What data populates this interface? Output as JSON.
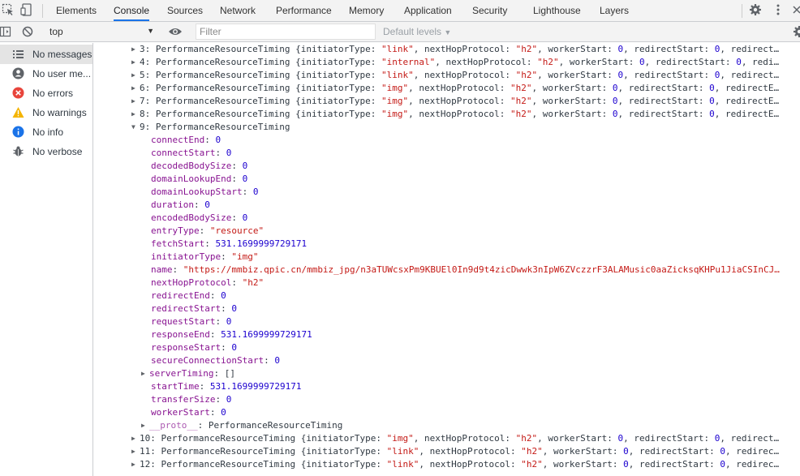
{
  "tabs": [
    "Elements",
    "Console",
    "Sources",
    "Network",
    "Performance",
    "Memory",
    "Application",
    "Security",
    "Lighthouse",
    "Layers"
  ],
  "toolbar": {
    "context": "top",
    "filter_placeholder": "Filter",
    "levels": "Default levels"
  },
  "sidebar": {
    "items": [
      {
        "label": "No messages",
        "icon": "list-icon"
      },
      {
        "label": "No user me...",
        "icon": "user-icon"
      },
      {
        "label": "No errors",
        "icon": "error-icon"
      },
      {
        "label": "No warnings",
        "icon": "warning-icon"
      },
      {
        "label": "No info",
        "icon": "info-icon"
      },
      {
        "label": "No verbose",
        "icon": "bug-icon"
      }
    ]
  },
  "colors": {
    "property": "#881391",
    "string": "#c41a16",
    "number": "#1c00cf",
    "accent": "#1a73e8"
  },
  "console": {
    "summary_rows": [
      {
        "index": "3:",
        "type": "PerformanceResourceTiming",
        "preview": " {initiatorType: ",
        "initiator": "\"link\"",
        "rest": ", nextHopProtocol: \"h2\", workerStart: 0, redirectStart: 0, redirect…"
      },
      {
        "index": "4:",
        "type": "PerformanceResourceTiming",
        "preview": " {initiatorType: ",
        "initiator": "\"internal\"",
        "rest": ", nextHopProtocol: \"h2\", workerStart: 0, redirectStart: 0, redi…"
      },
      {
        "index": "5:",
        "type": "PerformanceResourceTiming",
        "preview": " {initiatorType: ",
        "initiator": "\"link\"",
        "rest": ", nextHopProtocol: \"h2\", workerStart: 0, redirectStart: 0, redirect…"
      },
      {
        "index": "6:",
        "type": "PerformanceResourceTiming",
        "preview": " {initiatorType: ",
        "initiator": "\"img\"",
        "rest": ", nextHopProtocol: \"h2\", workerStart: 0, redirectStart: 0, redirectE…"
      },
      {
        "index": "7:",
        "type": "PerformanceResourceTiming",
        "preview": " {initiatorType: ",
        "initiator": "\"img\"",
        "rest": ", nextHopProtocol: \"h2\", workerStart: 0, redirectStart: 0, redirectE…"
      },
      {
        "index": "8:",
        "type": "PerformanceResourceTiming",
        "preview": " {initiatorType: ",
        "initiator": "\"img\"",
        "rest": ", nextHopProtocol: \"h2\", workerStart: 0, redirectStart: 0, redirectE…"
      }
    ],
    "expanded": {
      "index": "9:",
      "type": "PerformanceResourceTiming",
      "props": [
        {
          "key": "connectEnd",
          "value": "0",
          "kind": "num"
        },
        {
          "key": "connectStart",
          "value": "0",
          "kind": "num"
        },
        {
          "key": "decodedBodySize",
          "value": "0",
          "kind": "num"
        },
        {
          "key": "domainLookupEnd",
          "value": "0",
          "kind": "num"
        },
        {
          "key": "domainLookupStart",
          "value": "0",
          "kind": "num"
        },
        {
          "key": "duration",
          "value": "0",
          "kind": "num"
        },
        {
          "key": "encodedBodySize",
          "value": "0",
          "kind": "num"
        },
        {
          "key": "entryType",
          "value": "\"resource\"",
          "kind": "str"
        },
        {
          "key": "fetchStart",
          "value": "531.1699999729171",
          "kind": "num"
        },
        {
          "key": "initiatorType",
          "value": "\"img\"",
          "kind": "str"
        },
        {
          "key": "name",
          "value": "\"https://mmbiz.qpic.cn/mmbiz_jpg/n3aTUWcsxPm9KBUEl0In9d9t4zicDwwk3nIpW6ZVczzrF3ALAMusic0aaZicksqKHPu1JiaCSInCJ…",
          "kind": "str"
        },
        {
          "key": "nextHopProtocol",
          "value": "\"h2\"",
          "kind": "str"
        },
        {
          "key": "redirectEnd",
          "value": "0",
          "kind": "num"
        },
        {
          "key": "redirectStart",
          "value": "0",
          "kind": "num"
        },
        {
          "key": "requestStart",
          "value": "0",
          "kind": "num"
        },
        {
          "key": "responseEnd",
          "value": "531.1699999729171",
          "kind": "num"
        },
        {
          "key": "responseStart",
          "value": "0",
          "kind": "num"
        },
        {
          "key": "secureConnectionStart",
          "value": "0",
          "kind": "num"
        },
        {
          "key": "serverTiming",
          "value": "[]",
          "kind": "obj",
          "expandable": true
        },
        {
          "key": "startTime",
          "value": "531.1699999729171",
          "kind": "num"
        },
        {
          "key": "transferSize",
          "value": "0",
          "kind": "num"
        },
        {
          "key": "workerStart",
          "value": "0",
          "kind": "num"
        },
        {
          "key": "__proto__",
          "value": "PerformanceResourceTiming",
          "kind": "obj",
          "expandable": true,
          "dim": true
        }
      ]
    },
    "tail_rows": [
      {
        "index": "10:",
        "type": "PerformanceResourceTiming",
        "preview": " {initiatorType: ",
        "initiator": "\"img\"",
        "rest": ", nextHopProtocol: \"h2\", workerStart: 0, redirectStart: 0, redirect…"
      },
      {
        "index": "11:",
        "type": "PerformanceResourceTiming",
        "preview": " {initiatorType: ",
        "initiator": "\"link\"",
        "rest": ", nextHopProtocol: \"h2\", workerStart: 0, redirectStart: 0, redirec…"
      },
      {
        "index": "12:",
        "type": "PerformanceResourceTiming",
        "preview": " {initiatorType: ",
        "initiator": "\"link\"",
        "rest": ", nextHopProtocol: \"h2\", workerStart: 0, redirectStart: 0, redirec…"
      }
    ]
  }
}
